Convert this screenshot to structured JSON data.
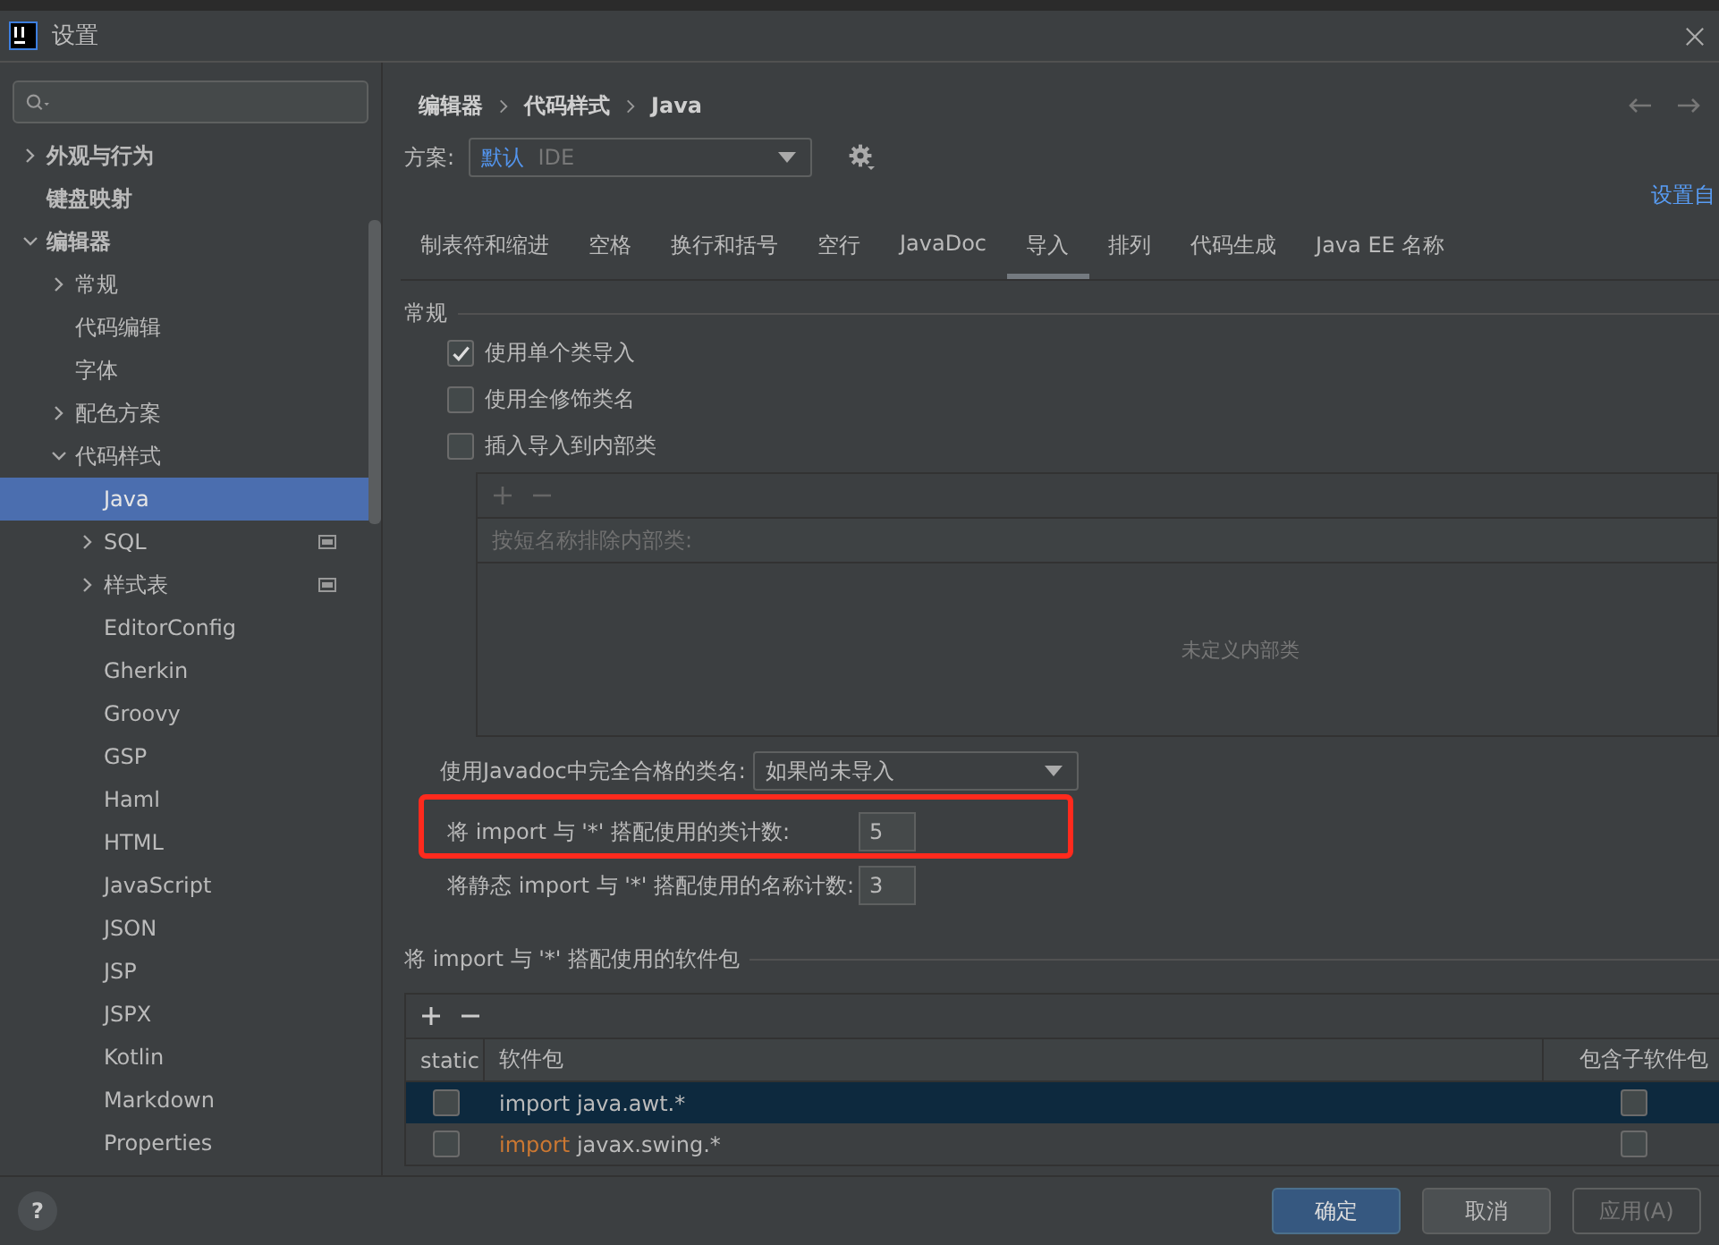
{
  "window": {
    "title": "设置"
  },
  "sidebar": {
    "items": [
      {
        "label": "外观与行为",
        "expanded": false,
        "selected": false,
        "bold": true
      },
      {
        "label": "键盘映射",
        "selected": false,
        "bold": true
      },
      {
        "label": "编辑器",
        "expanded": true,
        "selected": false,
        "bold": true,
        "children": [
          {
            "label": "常规",
            "expanded": false,
            "selected": false
          },
          {
            "label": "代码编辑",
            "selected": false
          },
          {
            "label": "字体",
            "selected": false
          },
          {
            "label": "配色方案",
            "expanded": false,
            "selected": false
          },
          {
            "label": "代码样式",
            "expanded": true,
            "selected": false,
            "children": [
              {
                "label": "Java",
                "selected": true
              },
              {
                "label": "SQL",
                "expanded": false,
                "selected": false,
                "project": true
              },
              {
                "label": "样式表",
                "expanded": false,
                "selected": false,
                "project": true
              },
              {
                "label": "EditorConfig",
                "selected": false
              },
              {
                "label": "Gherkin",
                "selected": false
              },
              {
                "label": "Groovy",
                "selected": false
              },
              {
                "label": "GSP",
                "selected": false
              },
              {
                "label": "Haml",
                "selected": false
              },
              {
                "label": "HTML",
                "selected": false
              },
              {
                "label": "JavaScript",
                "selected": false
              },
              {
                "label": "JSON",
                "selected": false
              },
              {
                "label": "JSP",
                "selected": false
              },
              {
                "label": "JSPX",
                "selected": false
              },
              {
                "label": "Kotlin",
                "selected": false
              },
              {
                "label": "Markdown",
                "selected": false
              },
              {
                "label": "Properties",
                "selected": false
              }
            ]
          }
        ]
      }
    ]
  },
  "breadcrumb": [
    "编辑器",
    "代码样式",
    "Java"
  ],
  "scheme": {
    "label": "方案:",
    "value": "默认",
    "suffix": "IDE"
  },
  "link": "设置自",
  "tabs": [
    {
      "label": "制表符和缩进",
      "selected": false
    },
    {
      "label": "空格",
      "selected": false
    },
    {
      "label": "换行和括号",
      "selected": false
    },
    {
      "label": "空行",
      "selected": false
    },
    {
      "label": "JavaDoc",
      "selected": false
    },
    {
      "label": "导入",
      "selected": true
    },
    {
      "label": "排列",
      "selected": false
    },
    {
      "label": "代码生成",
      "selected": false
    },
    {
      "label": "Java EE 名称",
      "selected": false
    }
  ],
  "general": {
    "title": "常规",
    "options": [
      {
        "label": "使用单个类导入",
        "checked": true
      },
      {
        "label": "使用全修饰类名",
        "checked": false
      },
      {
        "label": "插入导入到内部类",
        "checked": false
      }
    ],
    "inner_classes": {
      "header": "按短名称排除内部类:",
      "empty": "未定义内部类"
    }
  },
  "javadoc": {
    "label": "使用Javadoc中完全合格的类名:",
    "value": "如果尚未导入"
  },
  "counts": [
    {
      "label": "将 import 与 '*' 搭配使用的类计数:",
      "value": "5",
      "highlighted": true
    },
    {
      "label": "将静态 import 与 '*' 搭配使用的名称计数:",
      "value": "3",
      "highlighted": false
    }
  ],
  "packages": {
    "title": "将 import 与 '*' 搭配使用的软件包",
    "columns": [
      "static",
      "软件包",
      "包含子软件包"
    ],
    "rows": [
      {
        "static": false,
        "keyword": "import",
        "package": "java.awt.*",
        "subpackages": false,
        "selected": true
      },
      {
        "static": false,
        "keyword": "import",
        "package": "javax.swing.*",
        "subpackages": false,
        "selected": false
      }
    ]
  },
  "help": "?",
  "buttons": [
    {
      "label": "确定",
      "kind": "primary"
    },
    {
      "label": "取消",
      "kind": "normal"
    },
    {
      "label": "应用(A)",
      "kind": "disabled"
    }
  ]
}
